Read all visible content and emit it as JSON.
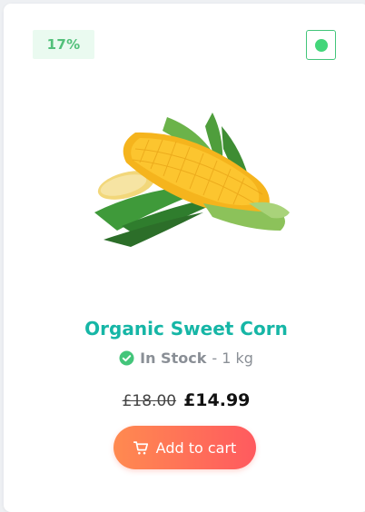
{
  "card": {
    "discount_badge": "17%",
    "product_name": "Organic Sweet Corn",
    "stock_status": "In Stock",
    "quantity": " - 1 kg",
    "old_price": "£18.00",
    "new_price": "£14.99",
    "add_to_cart_label": "Add to cart"
  },
  "icons": {
    "veg_mark": "veg-indicator-icon",
    "stock": "check-circle-icon",
    "cart": "shopping-cart-icon"
  },
  "colors": {
    "accent_teal": "#16b6a6",
    "badge_green": "#52c07a",
    "veg_green": "#43d67a",
    "button_gradient_start": "#ff8a50",
    "button_gradient_end": "#ff5a5f"
  }
}
